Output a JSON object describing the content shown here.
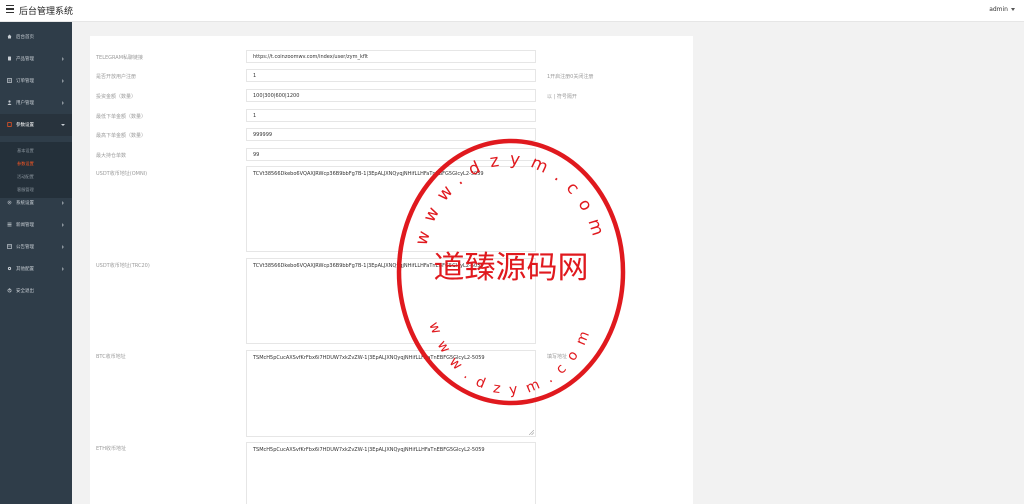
{
  "header": {
    "menu_icon": "hamburger-icon",
    "title": "后台管理系统",
    "user": "admin"
  },
  "sidebar": {
    "items": [
      {
        "label": "后台首页",
        "icon": "home-icon"
      },
      {
        "label": "产品管理",
        "icon": "product-icon"
      },
      {
        "label": "订单管理",
        "icon": "order-icon"
      },
      {
        "label": "用户管理",
        "icon": "user-icon"
      },
      {
        "label": "参数设置",
        "icon": "settings-doc-icon"
      },
      {
        "label": "系统设置",
        "icon": "gear-icon"
      },
      {
        "label": "新闻管理",
        "icon": "news-icon"
      },
      {
        "label": "公告管理",
        "icon": "notice-icon"
      },
      {
        "label": "其他配置",
        "icon": "config-icon"
      },
      {
        "label": "安全退出",
        "icon": "logout-icon"
      }
    ],
    "subitems": [
      "基本设置",
      "参数设置",
      "活动配置",
      "客服管理"
    ]
  },
  "form": {
    "rows": [
      {
        "label": "TELEGRAM私聊链接",
        "value": "https://t.coinzoomwv.com/index/user/zym_kflt",
        "hint": ""
      },
      {
        "label": "是否开放用户注册",
        "value": "1",
        "hint": "1开启注册0关闭注册"
      },
      {
        "label": "投资金额（数量）",
        "value": "100|300|600|1200",
        "hint": "以 | 符号隔开"
      },
      {
        "label": "最低下单金额（数量）",
        "value": "1",
        "hint": ""
      },
      {
        "label": "最高下单金额（数量）",
        "value": "999999",
        "hint": ""
      },
      {
        "label": "最大持仓单数",
        "value": "99",
        "hint": ""
      }
    ],
    "textareas": [
      {
        "label": "USDT收币地址(OMNI)",
        "value": "TCVt38566Dkebo6VQAXJRWcp36B9bbFg7B-1|3EpALJXNQyqjNHifLLHFaTnEBFG5GlcyL2-5059",
        "hint": ""
      },
      {
        "label": "USDT收币地址(TRC20)",
        "value": "TCVt38566Dkebo6VQAXJRWcp36B9bbFg7B-1|3EpALJXNQyqjNHifLLHFaTnEBFG5GlcyL2-5059",
        "hint": ""
      },
      {
        "label": "BTC收币地址",
        "value": "TSMcH5pCucAXSvfKrFbx6i7HDUW7xkZvZW-1|3EpALJXNQyqjNHifLLHFaTnEBFG5GlcyL2-5059",
        "hint": "填写地址"
      },
      {
        "label": "ETH收币地址",
        "value": "TSMcH5pCucAXSvfKrFbx6i7HDUW7xkZvZW-1|3EpALJXNQyqjNHifLLHFaTnEBFG5GlcyL2-5059",
        "hint": ""
      }
    ]
  },
  "watermark": {
    "text": "道臻源码网",
    "ring_top": "www.dzym.com",
    "ring_bottom": "www.dzym.com"
  },
  "colors": {
    "accent": "#ff5722",
    "stamp": "#e0191e",
    "sidebar": "#2f3d49"
  }
}
